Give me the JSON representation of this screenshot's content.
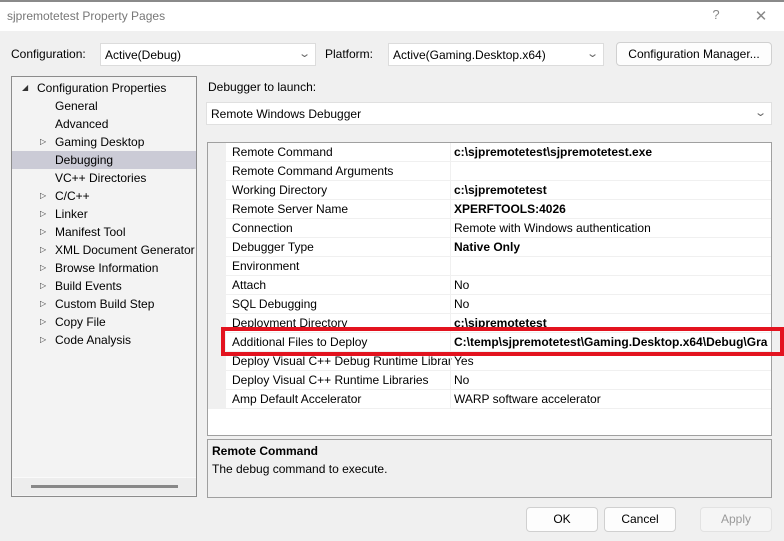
{
  "window": {
    "title": "sjpremotetest Property Pages",
    "help_glyph": "?",
    "close_glyph": "✕"
  },
  "toolbar": {
    "configuration_label": "Configuration:",
    "configuration_value": "Active(Debug)",
    "platform_label": "Platform:",
    "platform_value": "Active(Gaming.Desktop.x64)",
    "config_manager_label": "Configuration Manager...",
    "chevron_glyph": "⌄"
  },
  "tree": {
    "items": [
      {
        "label": "Configuration Properties",
        "expander": "◢",
        "level": 0,
        "selected": false
      },
      {
        "label": "General",
        "expander": "",
        "level": 1,
        "selected": false
      },
      {
        "label": "Advanced",
        "expander": "",
        "level": 1,
        "selected": false
      },
      {
        "label": "Gaming Desktop",
        "expander": "▷",
        "level": 1,
        "selected": false
      },
      {
        "label": "Debugging",
        "expander": "",
        "level": 1,
        "selected": true
      },
      {
        "label": "VC++ Directories",
        "expander": "",
        "level": 1,
        "selected": false
      },
      {
        "label": "C/C++",
        "expander": "▷",
        "level": 1,
        "selected": false
      },
      {
        "label": "Linker",
        "expander": "▷",
        "level": 1,
        "selected": false
      },
      {
        "label": "Manifest Tool",
        "expander": "▷",
        "level": 1,
        "selected": false
      },
      {
        "label": "XML Document Generator",
        "expander": "▷",
        "level": 1,
        "selected": false
      },
      {
        "label": "Browse Information",
        "expander": "▷",
        "level": 1,
        "selected": false
      },
      {
        "label": "Build Events",
        "expander": "▷",
        "level": 1,
        "selected": false
      },
      {
        "label": "Custom Build Step",
        "expander": "▷",
        "level": 1,
        "selected": false
      },
      {
        "label": "Copy File",
        "expander": "▷",
        "level": 1,
        "selected": false
      },
      {
        "label": "Code Analysis",
        "expander": "▷",
        "level": 1,
        "selected": false
      }
    ]
  },
  "debugger": {
    "label": "Debugger to launch:",
    "value": "Remote Windows Debugger"
  },
  "properties": [
    {
      "name": "Remote Command",
      "value": "c:\\sjpremotetest\\sjpremotetest.exe",
      "bold": true
    },
    {
      "name": "Remote Command Arguments",
      "value": "",
      "bold": false
    },
    {
      "name": "Working Directory",
      "value": "c:\\sjpremotetest",
      "bold": true
    },
    {
      "name": "Remote Server Name",
      "value": "XPERFTOOLS:4026",
      "bold": true
    },
    {
      "name": "Connection",
      "value": "Remote with Windows authentication",
      "bold": false
    },
    {
      "name": "Debugger Type",
      "value": "Native Only",
      "bold": true
    },
    {
      "name": "Environment",
      "value": "",
      "bold": false
    },
    {
      "name": "Attach",
      "value": "No",
      "bold": false
    },
    {
      "name": "SQL Debugging",
      "value": "No",
      "bold": false
    },
    {
      "name": "Deployment Directory",
      "value": "c:\\sjpremotetest",
      "bold": true
    },
    {
      "name": "Additional Files to Deploy",
      "value": "C:\\temp\\sjpremotetest\\Gaming.Desktop.x64\\Debug\\Gra",
      "bold": true,
      "highlighted": true
    },
    {
      "name": "Deploy Visual C++ Debug Runtime Librar",
      "value": "Yes",
      "bold": false
    },
    {
      "name": "Deploy Visual C++ Runtime Libraries",
      "value": "No",
      "bold": false
    },
    {
      "name": "Amp Default Accelerator",
      "value": "WARP software accelerator",
      "bold": false
    }
  ],
  "description": {
    "title": "Remote Command",
    "text": "The debug command to execute."
  },
  "buttons": {
    "ok": "OK",
    "cancel": "Cancel",
    "apply": "Apply"
  },
  "colors": {
    "highlight_border": "#e3131f",
    "selection": "#cbcbd6"
  }
}
